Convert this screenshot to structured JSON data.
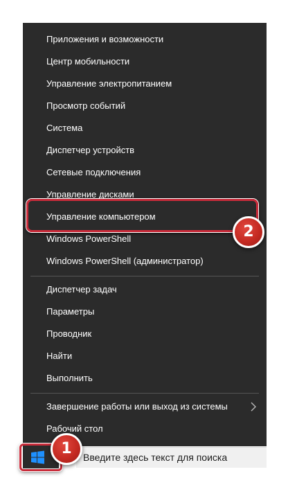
{
  "menu": {
    "items": [
      {
        "label": "Приложения и возможности"
      },
      {
        "label": "Центр мобильности"
      },
      {
        "label": "Управление электропитанием"
      },
      {
        "label": "Просмотр событий"
      },
      {
        "label": "Система"
      },
      {
        "label": "Диспетчер устройств"
      },
      {
        "label": "Сетевые подключения"
      },
      {
        "label": "Управление дисками"
      },
      {
        "label": "Управление компьютером"
      },
      {
        "label": "Windows PowerShell"
      },
      {
        "label": "Windows PowerShell (администратор)"
      },
      {
        "label": "Диспетчер задач"
      },
      {
        "label": "Параметры"
      },
      {
        "label": "Проводник"
      },
      {
        "label": "Найти"
      },
      {
        "label": "Выполнить"
      },
      {
        "label": "Завершение работы или выход из системы"
      },
      {
        "label": "Рабочий стол"
      }
    ],
    "submenu_icon": "chevron-right-icon"
  },
  "taskbar": {
    "start_icon": "windows-logo-icon",
    "search_text": "Введите здесь текст для поиска"
  },
  "annotations": {
    "step1": "1",
    "step2": "2",
    "highlight_color": "#c92b3a"
  },
  "colors": {
    "menu_bg": "#2b2b2b",
    "menu_text": "#ffffff",
    "windows_blue": "#1e90ff"
  }
}
